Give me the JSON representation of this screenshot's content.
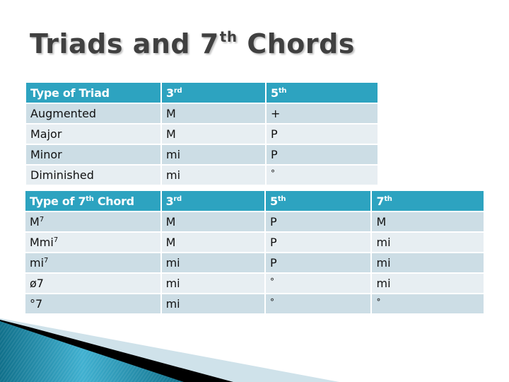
{
  "slide": {
    "title_pre": "Triads and 7",
    "title_sup": "th",
    "title_post": " Chords"
  },
  "triads": {
    "headers": [
      {
        "text": "Type of Triad",
        "sup": ""
      },
      {
        "text": "3",
        "sup": "rd"
      },
      {
        "text": "5",
        "sup": "th"
      }
    ],
    "rows": [
      {
        "type": "Augmented",
        "third": "M",
        "fifth": "+"
      },
      {
        "type": "Major",
        "third": "M",
        "fifth": "P"
      },
      {
        "type": "Minor",
        "third": "mi",
        "fifth": "P"
      },
      {
        "type": "Diminished",
        "third": "mi",
        "fifth": "°"
      }
    ]
  },
  "sevenths": {
    "headers": [
      {
        "text": "Type of 7",
        "sup": "th",
        "post": " Chord"
      },
      {
        "text": "3",
        "sup": "rd"
      },
      {
        "text": "5",
        "sup": "th"
      },
      {
        "text": "7",
        "sup": "th"
      }
    ],
    "rows": [
      {
        "type": "M",
        "type_sup": "7",
        "third": "M",
        "fifth": "P",
        "seventh": "M"
      },
      {
        "type": "Mmi",
        "type_sup": "7",
        "third": "M",
        "fifth": "P",
        "seventh": "mi"
      },
      {
        "type": "mi",
        "type_sup": "7",
        "third": "mi",
        "fifth": "P",
        "seventh": "mi"
      },
      {
        "type": "ø7",
        "type_sup": "",
        "third": "mi",
        "fifth": "°",
        "seventh": "mi"
      },
      {
        "type": "°7",
        "type_sup": "",
        "third": "mi",
        "fifth": "°",
        "seventh": "°"
      }
    ]
  },
  "colors": {
    "header_bg": "#2da3c0",
    "row_odd": "#ccdde5",
    "row_even": "#e7eef2",
    "title": "#404040"
  }
}
